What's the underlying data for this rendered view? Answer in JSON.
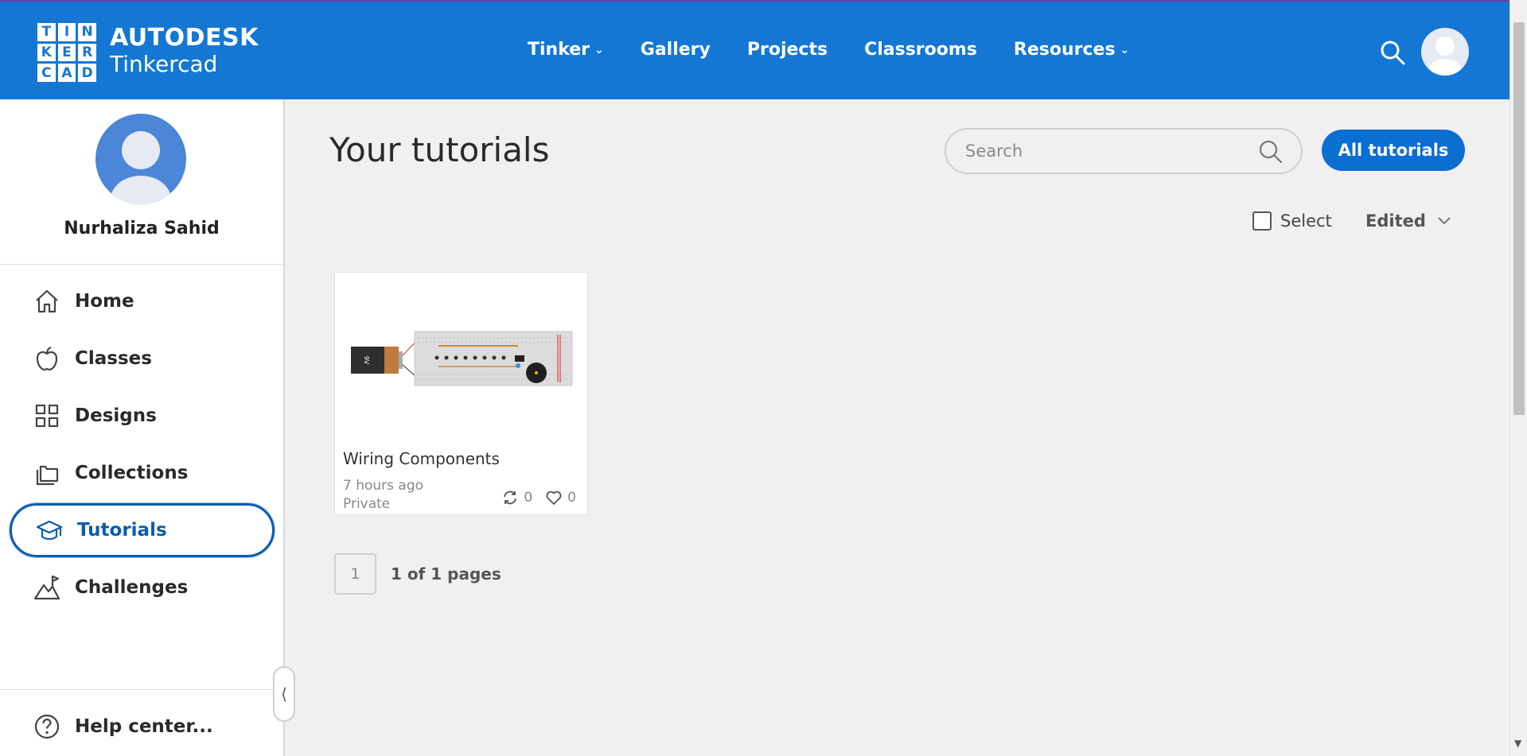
{
  "header": {
    "logo_letters": [
      "T",
      "I",
      "N",
      "K",
      "E",
      "R",
      "C",
      "A",
      "D"
    ],
    "brand_line1": "AUTODESK",
    "brand_line2": "Tinkercad",
    "nav": [
      {
        "label": "Tinker",
        "has_dropdown": true
      },
      {
        "label": "Gallery",
        "has_dropdown": false
      },
      {
        "label": "Projects",
        "has_dropdown": false
      },
      {
        "label": "Classrooms",
        "has_dropdown": false
      },
      {
        "label": "Resources",
        "has_dropdown": true
      }
    ],
    "brand_color": "#1477d4"
  },
  "sidebar": {
    "user_name": "Nurhaliza Sahid",
    "items": [
      {
        "label": "Home",
        "icon": "home-icon"
      },
      {
        "label": "Classes",
        "icon": "apple-icon"
      },
      {
        "label": "Designs",
        "icon": "grid-icon"
      },
      {
        "label": "Collections",
        "icon": "folders-icon"
      },
      {
        "label": "Tutorials",
        "icon": "graduation-cap-icon",
        "active": true
      },
      {
        "label": "Challenges",
        "icon": "mountain-flag-icon"
      }
    ],
    "help_label": "Help center..."
  },
  "main": {
    "title": "Your tutorials",
    "search_placeholder": "Search",
    "all_button": "All tutorials",
    "select_label": "Select",
    "sort_label": "Edited",
    "cards": [
      {
        "title": "Wiring Components",
        "time": "7 hours ago",
        "privacy": "Private",
        "remixes": "0",
        "likes": "0",
        "battery_label": "9V"
      }
    ],
    "pager_current": "1",
    "pager_text": "1 of 1 pages"
  }
}
